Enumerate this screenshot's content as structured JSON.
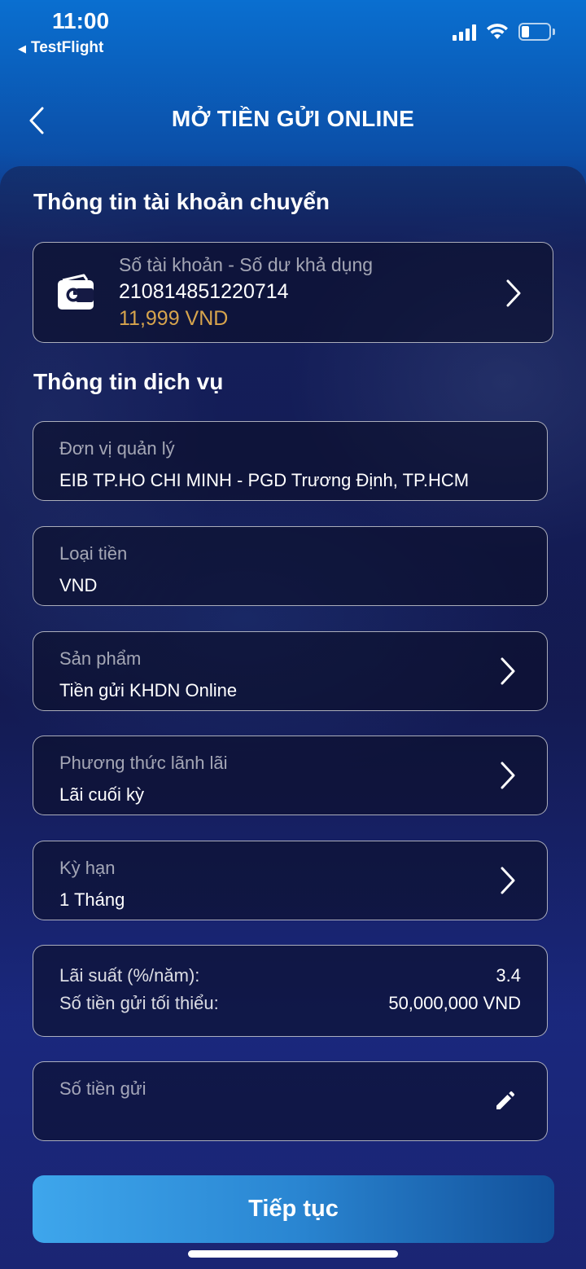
{
  "status_bar": {
    "time": "11:00",
    "back_app": "TestFlight"
  },
  "header": {
    "title": "MỞ TIỀN GỬI ONLINE",
    "back_icon": "chevron-left-icon"
  },
  "source_account": {
    "section_title": "Thông tin tài khoản chuyển",
    "label": "Số tài khoản - Số dư khả dụng",
    "account_number": "210814851220714",
    "balance": "11,999 VND",
    "balance_color": "#d7a44d"
  },
  "service": {
    "section_title": "Thông tin dịch vụ",
    "management_unit": {
      "label": "Đơn vị quản lý",
      "value": "EIB TP.HO CHI MINH - PGD Trương Định, TP.HCM"
    },
    "currency": {
      "label": "Loại tiền",
      "value": "VND"
    },
    "product": {
      "label": "Sản phẩm",
      "value": "Tiền gửi KHDN Online"
    },
    "interest_method": {
      "label": "Phương thức lãnh lãi",
      "value": "Lãi cuối kỳ"
    },
    "term": {
      "label": "Kỳ hạn",
      "value": "1 Tháng"
    },
    "rate": {
      "label": "Lãi suất (%/năm):",
      "value": "3.4"
    },
    "minimum": {
      "label": "Số tiền gửi tối thiểu:",
      "value": "50,000,000 VND"
    },
    "deposit_amount": {
      "placeholder": "Số tiền gửi",
      "value": ""
    }
  },
  "actions": {
    "continue_label": "Tiếp tục",
    "continue_color": "#2a86d2"
  }
}
